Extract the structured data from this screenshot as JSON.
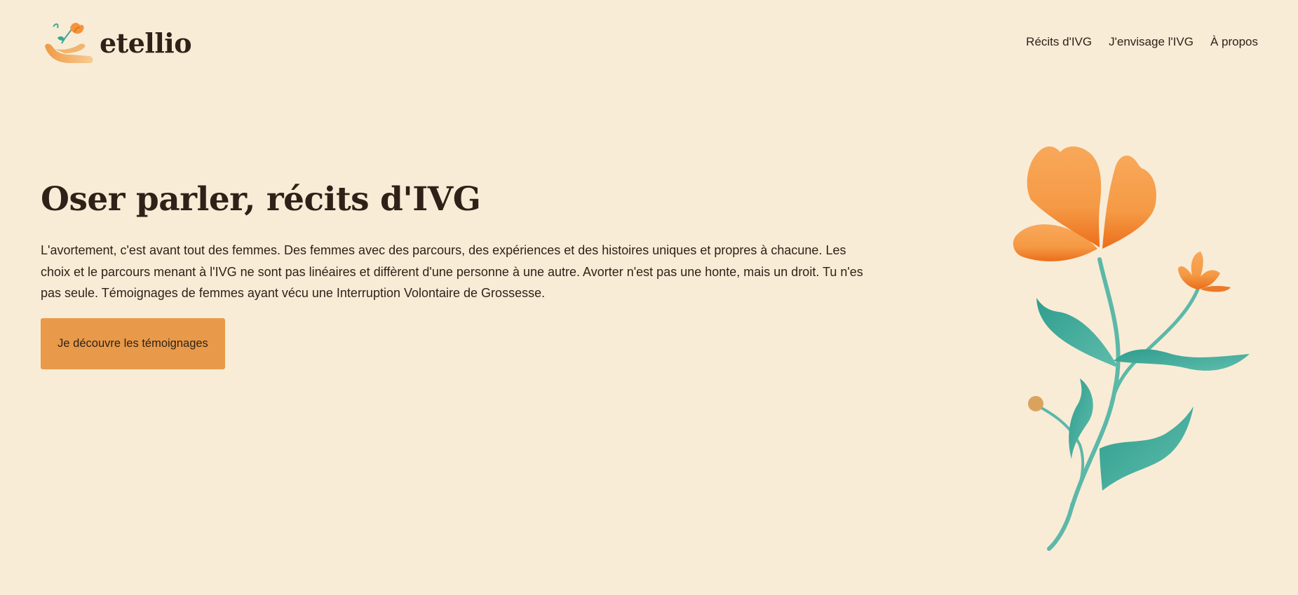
{
  "brand": {
    "name": "etellio",
    "icon": "hand-holding-flower-icon"
  },
  "nav": {
    "items": [
      {
        "label": "Récits d'IVG"
      },
      {
        "label": "J'envisage l'IVG"
      },
      {
        "label": "À propos"
      }
    ]
  },
  "hero": {
    "title": "Oser parler, récits d'IVG",
    "text": "L'avortement, c'est avant tout des femmes. Des femmes avec des parcours, des expériences et des histoires uniques et propres à chacune. Les choix et le parcours menant à l'IVG ne sont pas linéaires et diffèrent d'une personne à une autre. Avorter n'est pas une honte, mais un droit. Tu n'es pas seule. Témoignages de femmes ayant vécu une Interruption Volontaire de Grossesse.",
    "cta_label": "Je découvre les témoignages",
    "illustration": "orange-flower-illustration"
  },
  "colors": {
    "background": "#f8ecd7",
    "accent": "#e89a4a",
    "text": "#2e2218",
    "petal": "#f5933a",
    "leaf": "#3aa898"
  }
}
